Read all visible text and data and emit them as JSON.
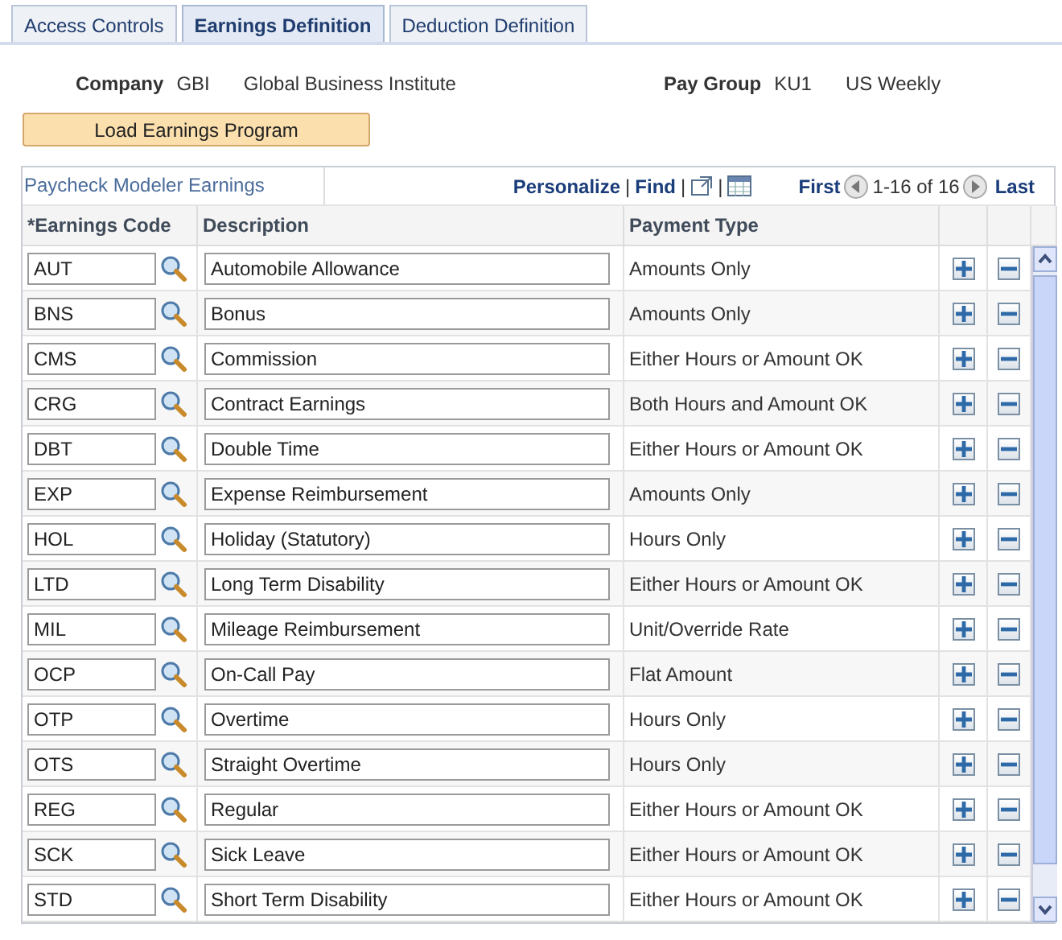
{
  "tabs": [
    {
      "label": "Access Controls",
      "selected": false
    },
    {
      "label": "Earnings Definition",
      "selected": true
    },
    {
      "label": "Deduction Definition",
      "selected": false
    }
  ],
  "header": {
    "company_label": "Company",
    "company_code": "GBI",
    "company_name": "Global Business Institute",
    "pay_group_label": "Pay Group",
    "pay_group_code": "KU1",
    "pay_group_name": "US Weekly"
  },
  "load_button": "Load Earnings Program",
  "grid": {
    "title": "Paycheck Modeler Earnings",
    "personalize": "Personalize",
    "separator_1": "|",
    "find": "Find",
    "separator_2": "|",
    "separator_3": "|",
    "first": "First",
    "range": "1-16 of 16",
    "last": "Last",
    "columns": [
      {
        "label": "*Earnings Code"
      },
      {
        "label": "Description"
      },
      {
        "label": "Payment Type"
      }
    ],
    "rows": [
      {
        "code": "AUT",
        "description": "Automobile Allowance",
        "payment_type": "Amounts Only"
      },
      {
        "code": "BNS",
        "description": "Bonus",
        "payment_type": "Amounts Only"
      },
      {
        "code": "CMS",
        "description": "Commission",
        "payment_type": "Either Hours or Amount OK"
      },
      {
        "code": "CRG",
        "description": "Contract Earnings",
        "payment_type": "Both Hours and Amount OK"
      },
      {
        "code": "DBT",
        "description": "Double Time",
        "payment_type": "Either Hours or Amount OK"
      },
      {
        "code": "EXP",
        "description": "Expense Reimbursement",
        "payment_type": "Amounts Only"
      },
      {
        "code": "HOL",
        "description": "Holiday (Statutory)",
        "payment_type": "Hours Only"
      },
      {
        "code": "LTD",
        "description": "Long Term Disability",
        "payment_type": "Either Hours or Amount OK"
      },
      {
        "code": "MIL",
        "description": "Mileage Reimbursement",
        "payment_type": "Unit/Override Rate"
      },
      {
        "code": "OCP",
        "description": "On-Call Pay",
        "payment_type": "Flat Amount"
      },
      {
        "code": "OTP",
        "description": "Overtime",
        "payment_type": "Hours Only"
      },
      {
        "code": "OTS",
        "description": "Straight Overtime",
        "payment_type": "Hours Only"
      },
      {
        "code": "REG",
        "description": "Regular",
        "payment_type": "Either Hours or Amount OK"
      },
      {
        "code": "SCK",
        "description": "Sick Leave",
        "payment_type": "Either Hours or Amount OK"
      },
      {
        "code": "STD",
        "description": "Short Term Disability",
        "payment_type": "Either Hours or Amount OK"
      }
    ]
  }
}
